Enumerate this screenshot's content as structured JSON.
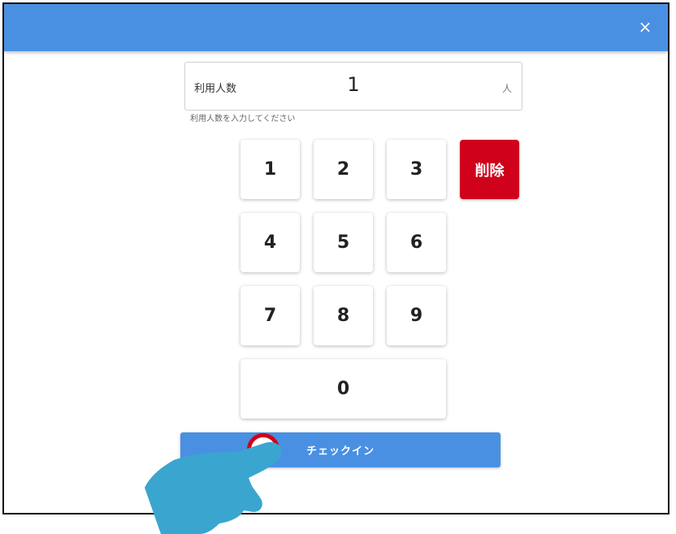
{
  "header": {
    "close_label": "×",
    "color": "#4a90e2"
  },
  "field": {
    "label": "利用人数",
    "value": "1",
    "unit": "人",
    "hint": "利用人数を入力してください"
  },
  "keypad": {
    "k1": "1",
    "k2": "2",
    "k3": "3",
    "k4": "4",
    "k5": "5",
    "k6": "6",
    "k7": "7",
    "k8": "8",
    "k9": "9",
    "k0": "0",
    "delete": "削除"
  },
  "checkin": {
    "label": "チェックイン"
  },
  "colors": {
    "accent": "#4a90e2",
    "danger": "#d0021b",
    "hand": "#3aa6cf"
  },
  "icons": {
    "close": "close-icon",
    "hand": "pointing-hand-icon"
  }
}
